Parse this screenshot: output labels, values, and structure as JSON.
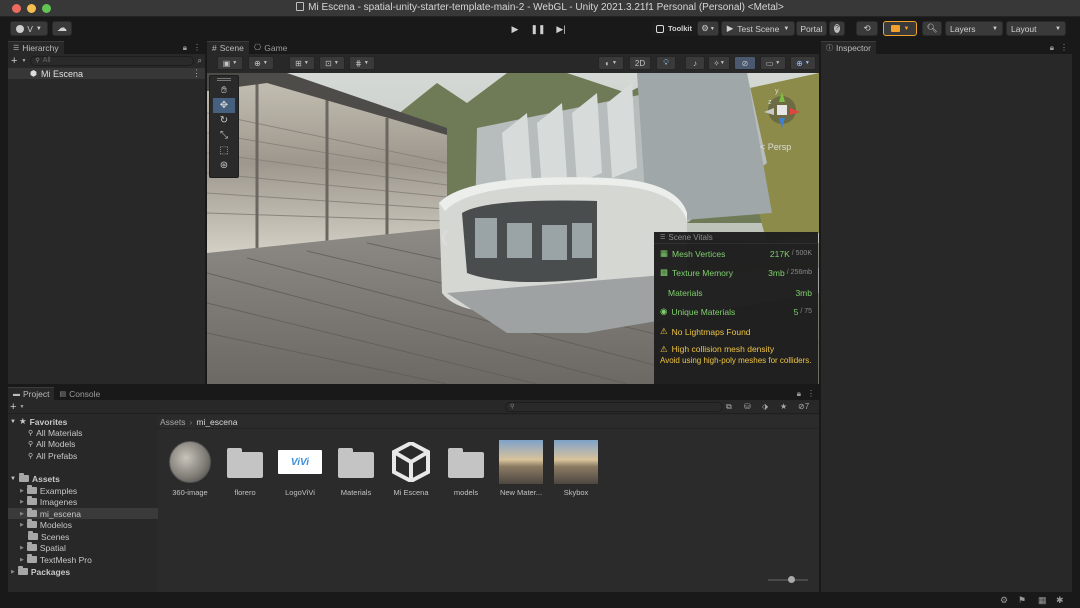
{
  "window": {
    "title": "Mi Escena - spatial-unity-starter-template-main-2 - WebGL - Unity 2021.3.21f1 Personal (Personal) <Metal>"
  },
  "toolbar": {
    "account_label": "V",
    "toolkit_label": "Toolkit",
    "test_scene_label": "Test Scene",
    "portal_label": "Portal",
    "layers_label": "Layers",
    "layout_label": "Layout"
  },
  "hierarchy": {
    "tab_label": "Hierarchy",
    "search_placeholder": "All",
    "scene_name": "Mi Escena"
  },
  "scene_view": {
    "tab_scene": "Scene",
    "tab_game": "Game",
    "mode_2d": "2D",
    "persp_label": "< Persp"
  },
  "scene_vitals": {
    "header": "Scene Vitals",
    "rows": [
      {
        "label": "Mesh Vertices",
        "value": "217K",
        "max": "/ 500K"
      },
      {
        "label": "Texture Memory",
        "value": "3mb",
        "max": "/ 256mb"
      },
      {
        "label": "Materials",
        "value": "3mb",
        "max": ""
      },
      {
        "label": "Unique Materials",
        "value": "5",
        "max": "/ 75"
      }
    ],
    "warning1": "No Lightmaps Found",
    "warning2_title": "High collision mesh density",
    "warning2_body": "Avoid using high-poly meshes for colliders."
  },
  "inspector": {
    "tab_label": "Inspector"
  },
  "project": {
    "tab_project": "Project",
    "tab_console": "Console",
    "hidden_count": "7",
    "breadcrumb": [
      "Assets",
      "mi_escena"
    ],
    "favorites_label": "Favorites",
    "favorites": [
      "All Materials",
      "All Models",
      "All Prefabs"
    ],
    "assets_label": "Assets",
    "asset_folders": [
      "Examples",
      "Imagenes",
      "mi_escena",
      "Modelos",
      "Scenes",
      "Spatial",
      "TextMesh Pro"
    ],
    "packages_label": "Packages",
    "grid_items": [
      {
        "label": "360-image"
      },
      {
        "label": "florero"
      },
      {
        "label": "LogoViVi",
        "logo_text": "ViVi"
      },
      {
        "label": "Materials"
      },
      {
        "label": "Mi Escena"
      },
      {
        "label": "models"
      },
      {
        "label": "New Mater..."
      },
      {
        "label": "Skybox"
      }
    ]
  },
  "colors": {
    "accent": "#3a79bb",
    "vitals_green": "#7fd36b",
    "warning_yellow": "#f2c744",
    "toolbar_orange": "#f1a22d"
  }
}
